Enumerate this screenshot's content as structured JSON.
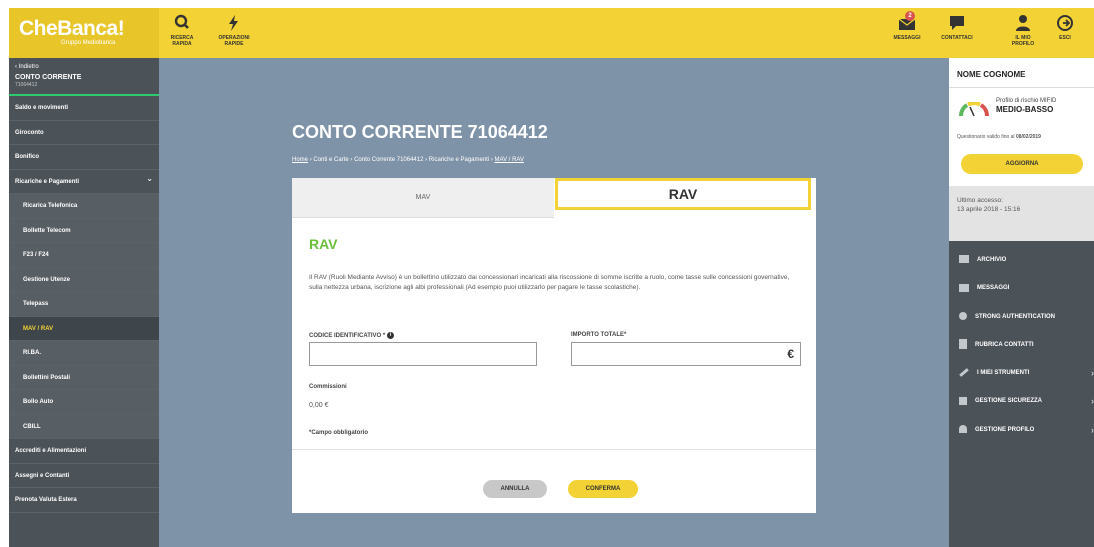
{
  "header": {
    "logo_name": "CheBanca!",
    "logo_sub": "Gruppo Mediobanca",
    "quick_search": "RICERCA RAPIDA",
    "quick_ops": "OPERAZIONI RAPIDE",
    "messages": "MESSAGGI",
    "messages_count": "2",
    "contacts": "CONTATTACI",
    "profile": "IL MIO PROFILO",
    "exit": "ESCI"
  },
  "sidebar": {
    "back": "‹ Indietro",
    "account_title": "CONTO CORRENTE",
    "account_number": "71064412",
    "items": [
      "Saldo e movimenti",
      "Giroconto",
      "Bonifico",
      "Ricariche e Pagamenti",
      "Ricarica Telefonica",
      "Bollette Telecom",
      "F23 / F24",
      "Gestione Utenze",
      "Telepass",
      "MAV / RAV",
      "RI.BA.",
      "Bollettini Postali",
      "Bollo Auto",
      "CBILL",
      "Accrediti e Alimentazioni",
      "Assegni e Contanti",
      "Prenota Valuta Estera"
    ]
  },
  "main": {
    "title": "CONTO CORRENTE 71064412",
    "breadcrumb": [
      "Home",
      "Conti e Carte",
      "Conto Corrente 71064412",
      "Ricariche e Pagamenti",
      "MAV / RAV"
    ],
    "tabs": [
      "MAV",
      "RAV"
    ],
    "section_title": "RAV",
    "description": "Il RAV (Ruoli Mediante Avviso) è un bollettino utilizzato dai concessionari incaricati alla riscossione di somme iscritte a ruolo, come tasse sulle concessioni governative, sulla nettezza urbana, iscrizione agli albi professionali (Ad esempio puoi utilizzarlo per pagare le tasse scolastiche).",
    "code_label": "CODICE IDENTIFICATIVO *",
    "code_value": "",
    "amount_label": "IMPORTO TOTALE*",
    "amount_value": "",
    "currency": "€",
    "fees_label": "Commissioni",
    "fees_value": "0,00 €",
    "required_note": "*Campo obbligatorio",
    "cancel": "ANNULLA",
    "confirm": "CONFERMA"
  },
  "rightpanel": {
    "name": "NOME COGNOME",
    "risk_label": "Profilo di rischio MIFID",
    "risk_level": "MEDIO-BASSO",
    "questionnaire_text": "Questionario valido fino al",
    "questionnaire_date": "08/02/2019",
    "update": "AGGIORNA",
    "last_access_label": "Ultimo accesso:",
    "last_access_value": "13 aprile 2018 - 15:16",
    "menu": [
      "ARCHIVIO",
      "MESSAGGI",
      "STRONG AUTHENTICATION",
      "RUBRICA CONTATTI",
      "I MIEI STRUMENTI",
      "GESTIONE SICUREZZA",
      "GESTIONE PROFILO"
    ]
  },
  "colors": {
    "brand_yellow": "#f2d234",
    "accent_green": "#6bbf3a",
    "sidebar": "#4b5258",
    "background": "#7f93a8"
  }
}
